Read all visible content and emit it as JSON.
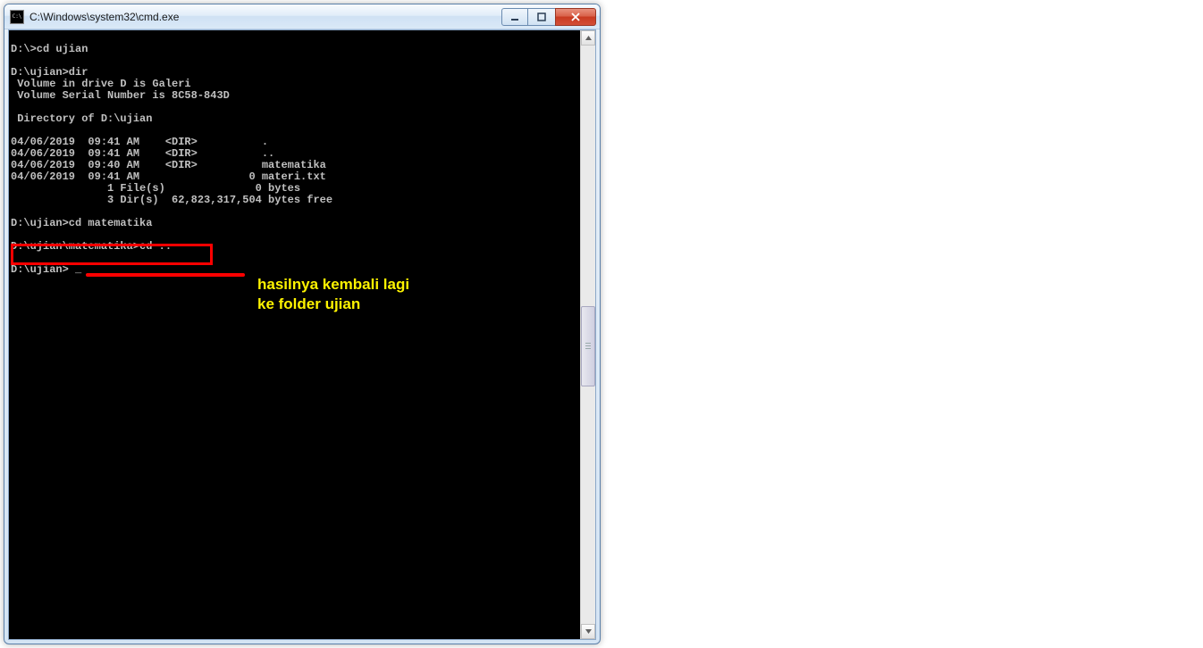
{
  "window": {
    "title": "C:\\Windows\\system32\\cmd.exe"
  },
  "terminal": {
    "lines": [
      "",
      "D:\\>cd ujian",
      "",
      "D:\\ujian>dir",
      " Volume in drive D is Galeri",
      " Volume Serial Number is 8C58-843D",
      "",
      " Directory of D:\\ujian",
      "",
      "04/06/2019  09:41 AM    <DIR>          .",
      "04/06/2019  09:41 AM    <DIR>          ..",
      "04/06/2019  09:40 AM    <DIR>          matematika",
      "04/06/2019  09:41 AM                 0 materi.txt",
      "               1 File(s)              0 bytes",
      "               3 Dir(s)  62,823,317,504 bytes free",
      "",
      "D:\\ujian>cd matematika",
      "",
      "D:\\ujian\\matematika>cd ..",
      "",
      "D:\\ujian> _"
    ]
  },
  "annotation": {
    "line1": "hasilnya kembali lagi",
    "line2": "ke folder ujian"
  }
}
